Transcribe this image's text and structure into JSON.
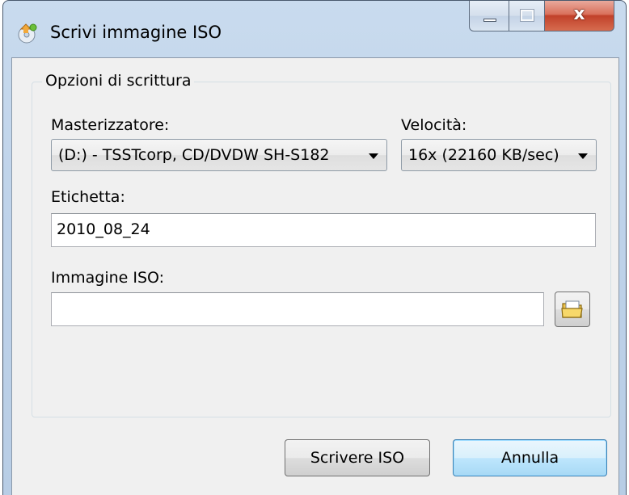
{
  "window": {
    "title": "Scrivi immagine ISO",
    "close_glyph": "x"
  },
  "group": {
    "legend": "Opzioni di scrittura"
  },
  "burner": {
    "label": "Masterizzatore:",
    "selected": "(D:) - TSSTcorp, CD/DVDW SH-S182"
  },
  "speed": {
    "label": "Velocità:",
    "selected": "16x (22160 KB/sec)"
  },
  "label_field": {
    "label": "Etichetta:",
    "value": "2010_08_24"
  },
  "iso_image": {
    "label": "Immagine ISO:",
    "value": ""
  },
  "buttons": {
    "write": "Scrivere ISO",
    "cancel": "Annulla"
  },
  "icons": {
    "app": "disc-burn-icon",
    "browse": "open-folder-icon"
  }
}
